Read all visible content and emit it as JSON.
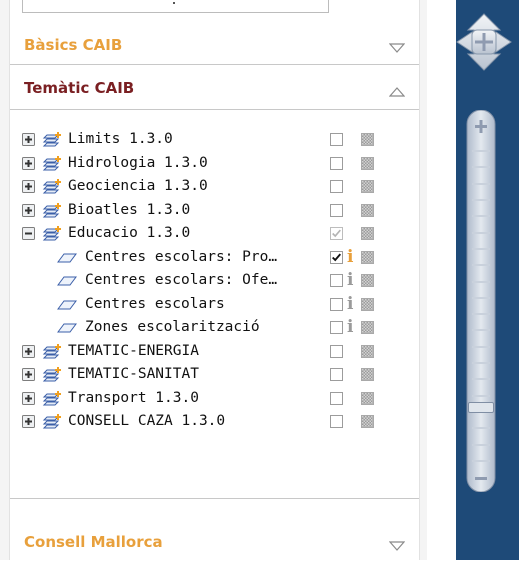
{
  "sections": {
    "basics": {
      "title": "Bàsics CAIB",
      "state": "collapsed"
    },
    "tematic": {
      "title": "Temàtic CAIB",
      "state": "expanded"
    },
    "consell": {
      "title": "Consell Mallorca",
      "state": "collapsed"
    }
  },
  "layers": [
    {
      "label": "Limits 1.3.0",
      "kind": "group",
      "expanded": false,
      "checked": false
    },
    {
      "label": "Hidrologia 1.3.0",
      "kind": "group",
      "expanded": false,
      "checked": false
    },
    {
      "label": "Geociencia 1.3.0",
      "kind": "group",
      "expanded": false,
      "checked": false
    },
    {
      "label": "Bioatles 1.3.0",
      "kind": "group",
      "expanded": false,
      "checked": false
    },
    {
      "label": "Educacio 1.3.0",
      "kind": "group",
      "expanded": true,
      "checked": "partial"
    },
    {
      "label": "Centres escolars: Pro…",
      "kind": "sublayer",
      "checked": true,
      "info": "active"
    },
    {
      "label": "Centres escolars: Ofe…",
      "kind": "sublayer",
      "checked": false,
      "info": "inactive"
    },
    {
      "label": "Centres escolars",
      "kind": "sublayer",
      "checked": false,
      "info": "inactive"
    },
    {
      "label": "Zones escolarització",
      "kind": "sublayer",
      "checked": false,
      "info": "inactive"
    },
    {
      "label": "TEMATIC-ENERGIA",
      "kind": "group",
      "expanded": false,
      "checked": false
    },
    {
      "label": "TEMATIC-SANITAT",
      "kind": "group",
      "expanded": false,
      "checked": false
    },
    {
      "label": "Transport 1.3.0",
      "kind": "group",
      "expanded": false,
      "checked": false
    },
    {
      "label": "CONSELL CAZA 1.3.0",
      "kind": "group",
      "expanded": false,
      "checked": false
    }
  ],
  "zoom": {
    "level": 0.17,
    "levels": 20
  },
  "colors": {
    "section_orange": "#e8a03c",
    "section_maroon": "#7a1f22",
    "nav_background": "#1e4a78",
    "info_active": "#e8a03c",
    "info_inactive": "#9a9a9a"
  },
  "icons": {
    "expand": "plus-box-icon",
    "collapse": "minus-box-icon",
    "group": "layers-icon",
    "sublayer": "layer-shape-icon",
    "legend": "legend-icon",
    "info": "info-icon",
    "pan": "pan-arrows-icon",
    "zoom_in": "zoom-in-icon",
    "zoom_out": "zoom-out-icon"
  }
}
